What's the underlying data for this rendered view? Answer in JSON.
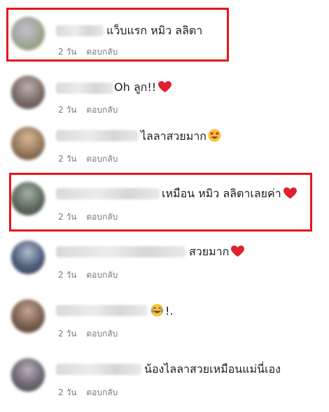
{
  "comments": [
    {
      "text": "แว็บแรก หมิว ลลิตา",
      "time": "2 วัน",
      "reply": "ตอบกลับ",
      "emoji": "none",
      "highlight": true,
      "avatar_colors": [
        "#9aa88a",
        "#b9b0c6",
        "#7c8f6f"
      ]
    },
    {
      "text": "Oh ลูก!!",
      "time": "2 วัน",
      "reply": "ตอบกลับ",
      "emoji": "heart",
      "highlight": false,
      "avatar_colors": [
        "#6d5a52",
        "#a79c9e",
        "#3e3432"
      ]
    },
    {
      "text": "ไลลาสวยมาก",
      "time": "2 วัน",
      "reply": "ตอบกลับ",
      "emoji": "heart-eyes",
      "highlight": false,
      "avatar_colors": [
        "#8a6a4a",
        "#c9a07a",
        "#4a3426"
      ]
    },
    {
      "text": "เหมือน หมิว ลลิตาเลยค่า",
      "time": "2 วัน",
      "reply": "ตอบกลับ",
      "emoji": "heart",
      "highlight": true,
      "avatar_colors": [
        "#4a5a4c",
        "#8e9a8d",
        "#2e3a30"
      ]
    },
    {
      "text": "สวยมาก",
      "time": "2 วัน",
      "reply": "ตอบกลับ",
      "emoji": "heart",
      "highlight": false,
      "avatar_colors": [
        "#3b4a6a",
        "#9aa7bf",
        "#262c3c"
      ]
    },
    {
      "text": "!.",
      "time": "2 วัน",
      "reply": "ตอบกลับ",
      "emoji": "joy",
      "highlight": false,
      "avatar_colors": [
        "#6a4e3c",
        "#b38f7b",
        "#3a2820"
      ]
    },
    {
      "text": "น้องไลลาสวยเหมือนแม่นี่เอง",
      "time": "2 วัน",
      "reply": "ตอบกลับ",
      "emoji": "none",
      "highlight": false,
      "avatar_colors": [
        "#5c5660",
        "#a89aa8",
        "#35303a"
      ]
    }
  ],
  "colors": {
    "highlight": "#e5161b",
    "heart": "#e0202c",
    "meta": "#7a7a7a"
  }
}
